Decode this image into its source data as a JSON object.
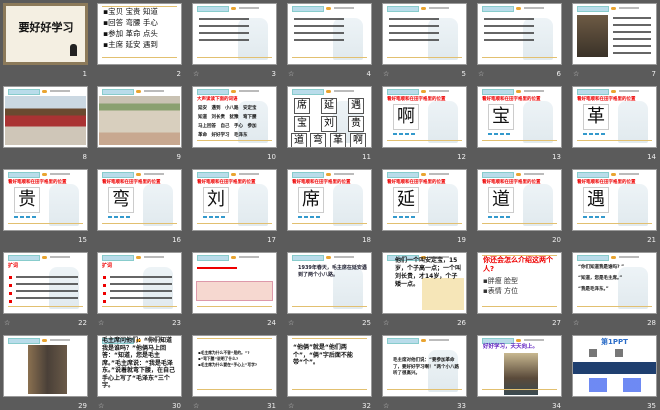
{
  "slides": [
    {
      "n": "1",
      "type": "title",
      "title": "要好好学习"
    },
    {
      "n": "2",
      "type": "bullets",
      "items": [
        "宝贝 宝贵 知道",
        "回答 弯腰 手心",
        "参加 革命 点头",
        "主席 延安 遇到"
      ]
    },
    {
      "n": "3",
      "type": "text",
      "star": true
    },
    {
      "n": "4",
      "type": "text",
      "star": true
    },
    {
      "n": "5",
      "type": "text",
      "star": true
    },
    {
      "n": "6",
      "type": "text",
      "star": true
    },
    {
      "n": "7",
      "type": "portrait",
      "star": true
    },
    {
      "n": "8",
      "type": "photo",
      "photo": "tiananmen"
    },
    {
      "n": "9",
      "type": "photo",
      "photo": "yanan"
    },
    {
      "n": "10",
      "type": "words",
      "lines": [
        "延安　遇到　小八路　安定宝",
        "知道　刘长贵　犹豫　弯下腰",
        "马上回答　自己　手心　参加",
        "革命　好好学习　毛泽东"
      ]
    },
    {
      "n": "11",
      "type": "grid",
      "chars": [
        "席",
        "延",
        "遇",
        "宝",
        "刘",
        "贵",
        "道",
        "弯",
        "革",
        "啊"
      ]
    },
    {
      "n": "12",
      "type": "char",
      "title": "看好笔顺和在田字格里的位置",
      "char": "啊"
    },
    {
      "n": "13",
      "type": "char",
      "title": "看好笔顺和在田字格里的位置",
      "char": "宝"
    },
    {
      "n": "14",
      "type": "char",
      "title": "看好笔顺和在田字格里的位置",
      "char": "革"
    },
    {
      "n": "15",
      "type": "char",
      "title": "看好笔顺和在田字格里的位置",
      "char": "贵"
    },
    {
      "n": "16",
      "type": "char",
      "title": "看好笔顺和在田字格里的位置",
      "char": "弯"
    },
    {
      "n": "17",
      "type": "char",
      "title": "看好笔顺和在田字格里的位置",
      "char": "刘"
    },
    {
      "n": "18",
      "type": "char",
      "title": "看好笔顺和在田字格里的位置",
      "char": "席"
    },
    {
      "n": "19",
      "type": "char",
      "title": "看好笔顺和在田字格里的位置",
      "char": "延"
    },
    {
      "n": "20",
      "type": "char",
      "title": "看好笔顺和在田字格里的位置",
      "char": "道"
    },
    {
      "n": "21",
      "type": "char",
      "title": "看好笔顺和在田字格里的位置",
      "char": "遇"
    },
    {
      "n": "22",
      "type": "expand",
      "title": "扩词",
      "star": true
    },
    {
      "n": "23",
      "type": "expand",
      "title": "扩词",
      "star": true
    },
    {
      "n": "24",
      "type": "table"
    },
    {
      "n": "25",
      "type": "story",
      "star": true,
      "text": "1939年春天，毛主席在延安遇到了两个小八路。"
    },
    {
      "n": "26",
      "type": "story2",
      "star": true,
      "text": "他们一个叫安定宝，15岁，个子高一点；一个叫刘长贵，才14岁，个子矮一点。"
    },
    {
      "n": "27",
      "type": "question",
      "title": "你还会怎么介绍这两个人?",
      "items": [
        "胖瘦 脸型",
        "表情 方位"
      ]
    },
    {
      "n": "28",
      "type": "quotes",
      "star": true,
      "lines": [
        "“你们知道我是谁吗? ”",
        "“知道，您是毛主席。”",
        "“我是毛泽东。”"
      ]
    },
    {
      "n": "29",
      "type": "photo",
      "photo": "group"
    },
    {
      "n": "30",
      "type": "story3",
      "star": true,
      "text": "毛主席问他们：“你们知道我是谁吗？”他俩马上回答：“知道，您是毛主席。”毛主席说：“我是毛泽东。”说着就弯下腰，在自己手心上写了“毛泽东”三个字。"
    },
    {
      "n": "31",
      "type": "qlist",
      "star": true,
      "items": [
        "毛主席为什么不答“是的。”?",
        "“弯下腰”说明了什么?",
        "毛主席为什么要在“手心上”写字?"
      ]
    },
    {
      "n": "32",
      "type": "note",
      "star": true,
      "text": "“他俩”就是“他们两个”，“俩”字后面不能带“个”。"
    },
    {
      "n": "33",
      "type": "story4",
      "star": true,
      "text": "毛主席对他们说：“要参加革命了，要好好学习啊！”两个小八路听了很高兴。"
    },
    {
      "n": "34",
      "type": "motto",
      "text": "好好学习，天天向上。"
    },
    {
      "n": "35",
      "type": "ad",
      "brand": "第1PPT"
    }
  ],
  "star_glyph": "☆"
}
